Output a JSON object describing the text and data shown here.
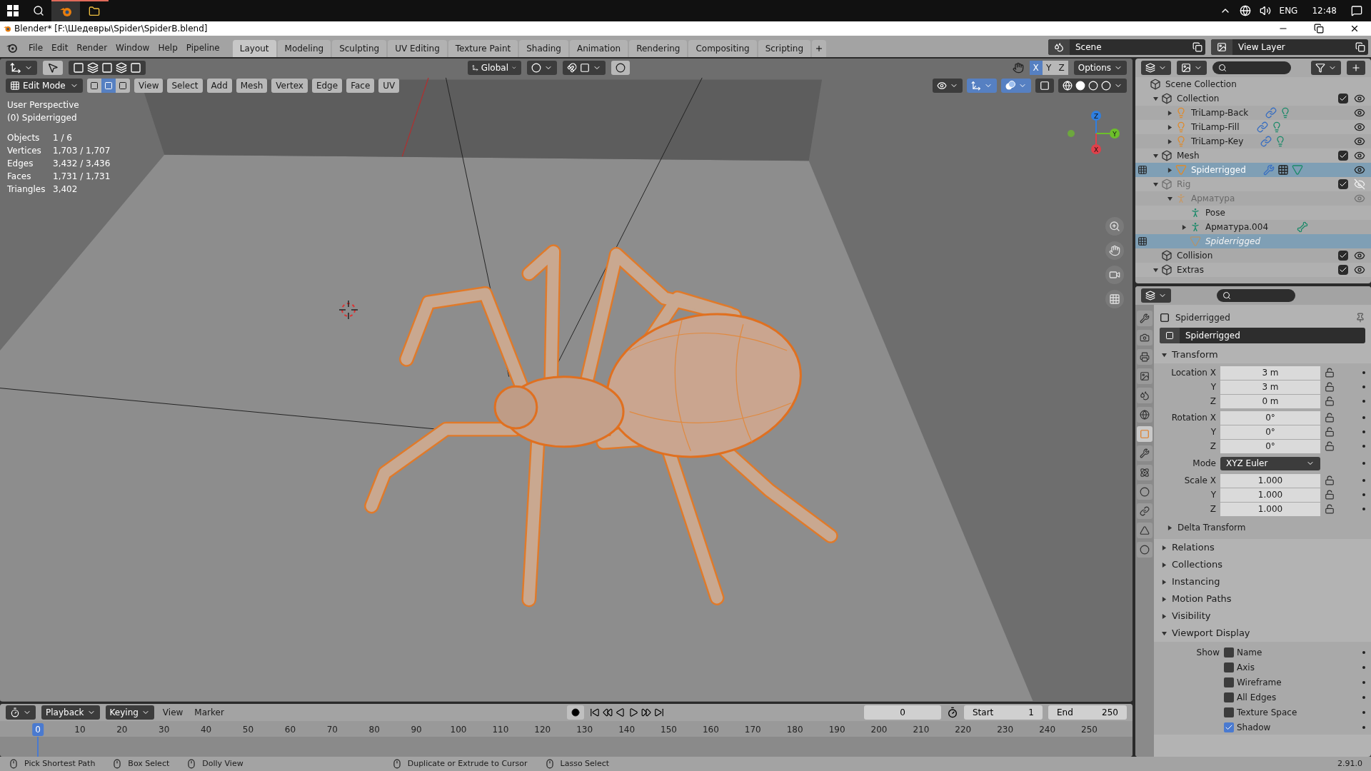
{
  "taskbar": {
    "language": "ENG",
    "time": "12:48"
  },
  "window": {
    "title": "Blender* [F:\\Шедевры\\Spider\\SpiderB.blend]"
  },
  "topbar": {
    "menus": [
      "File",
      "Edit",
      "Render",
      "Window",
      "Help",
      "Pipeline"
    ],
    "workspaces": [
      {
        "label": "Layout",
        "selected": true
      },
      {
        "label": "Modeling",
        "selected": false
      },
      {
        "label": "Sculpting",
        "selected": false
      },
      {
        "label": "UV Editing",
        "selected": false
      },
      {
        "label": "Texture Paint",
        "selected": false
      },
      {
        "label": "Shading",
        "selected": false
      },
      {
        "label": "Animation",
        "selected": false
      },
      {
        "label": "Rendering",
        "selected": false
      },
      {
        "label": "Compositing",
        "selected": false
      },
      {
        "label": "Scripting",
        "selected": false
      }
    ],
    "scene": "Scene",
    "view_layer": "View Layer"
  },
  "viewport": {
    "orientation": "Global",
    "mirror_axes": [
      {
        "label": "X",
        "selected": true
      },
      {
        "label": "Y",
        "selected": false
      },
      {
        "label": "Z",
        "selected": false
      }
    ],
    "options": "Options",
    "mode": "Edit Mode",
    "select_modes": [
      {
        "selected": false
      },
      {
        "selected": true
      },
      {
        "selected": false
      }
    ],
    "menus": [
      "View",
      "Select",
      "Add",
      "Mesh",
      "Vertex",
      "Edge",
      "Face",
      "UV"
    ],
    "gizmos": {
      "selected": true
    },
    "overlays": {
      "selected": true
    },
    "info": [
      "User Perspective",
      "(0) Spiderrigged"
    ],
    "stats": [
      {
        "label": "Objects",
        "value": "1 / 6"
      },
      {
        "label": "Vertices",
        "value": "1,703 / 1,707"
      },
      {
        "label": "Edges",
        "value": "3,432 / 3,436"
      },
      {
        "label": "Faces",
        "value": "1,731 / 1,731"
      },
      {
        "label": "Triangles",
        "value": "3,402"
      }
    ],
    "gizmo_axes": [
      {
        "label": "Z",
        "color": "#2f7fe0"
      },
      {
        "label": "Y",
        "color": "#6cbf2a"
      },
      {
        "label": "X",
        "color": "#e0404a"
      }
    ]
  },
  "outliner": {
    "root": "Scene Collection",
    "items": [
      {
        "name": "Collection",
        "kind": "collection",
        "expanded": true,
        "selected": false,
        "dimmed": false,
        "checked": true,
        "visible": true,
        "children": [
          {
            "name": "TriLamp-Back",
            "kind": "light",
            "expanded": false,
            "selected": false,
            "dimmed": false,
            "visible": true
          },
          {
            "name": "TriLamp-Fill",
            "kind": "light",
            "expanded": false,
            "selected": false,
            "dimmed": false,
            "visible": true
          },
          {
            "name": "TriLamp-Key",
            "kind": "light",
            "expanded": false,
            "selected": false,
            "dimmed": false,
            "visible": true
          }
        ]
      },
      {
        "name": "Mesh",
        "kind": "collection",
        "expanded": true,
        "selected": false,
        "dimmed": false,
        "checked": true,
        "visible": true,
        "children": [
          {
            "name": "Spiderrigged",
            "kind": "mesh",
            "expanded": false,
            "selected": true,
            "dimmed": false,
            "visible": true
          }
        ]
      },
      {
        "name": "Rig",
        "kind": "collection",
        "expanded": true,
        "selected": false,
        "dimmed": true,
        "checked": true,
        "visible": false,
        "children": [
          {
            "name": "Арматура",
            "kind": "armature",
            "expanded": true,
            "selected": false,
            "dimmed": true,
            "visible": true,
            "children": [
              {
                "name": "Pose",
                "kind": "pose",
                "selected": false,
                "dimmed": false
              },
              {
                "name": "Арматура.004",
                "kind": "armature_data",
                "expanded": false,
                "selected": false,
                "dimmed": false
              },
              {
                "name": "Spiderrigged",
                "kind": "mesh",
                "selected": true,
                "dimmed": true
              }
            ]
          }
        ]
      },
      {
        "name": "Collision",
        "kind": "collection",
        "selected": false,
        "dimmed": false,
        "checked": true,
        "visible": true
      },
      {
        "name": "Extras",
        "kind": "collection",
        "expanded": true,
        "selected": false,
        "dimmed": false,
        "checked": true,
        "visible": true
      }
    ]
  },
  "properties": {
    "tabs": [
      {
        "selected": false
      },
      {
        "selected": false
      },
      {
        "selected": false
      },
      {
        "selected": false
      },
      {
        "selected": false
      },
      {
        "selected": false
      },
      {
        "selected": true
      },
      {
        "selected": false
      },
      {
        "selected": false
      },
      {
        "selected": false
      },
      {
        "selected": false
      },
      {
        "selected": false
      },
      {
        "selected": false
      }
    ],
    "object": "Spiderrigged",
    "datablock": "Spiderrigged",
    "transform": {
      "label": "Transform",
      "expanded": true,
      "groups": [
        {
          "kind": "numbers",
          "rows": [
            {
              "label": "Location X",
              "value": "3 m"
            },
            {
              "label": "Y",
              "value": "3 m"
            },
            {
              "label": "Z",
              "value": "0 m"
            }
          ]
        },
        {
          "kind": "numbers",
          "rows": [
            {
              "label": "Rotation X",
              "value": "0°"
            },
            {
              "label": "Y",
              "value": "0°"
            },
            {
              "label": "Z",
              "value": "0°"
            }
          ]
        },
        {
          "kind": "dropdown",
          "label": "Mode",
          "value": "XYZ Euler"
        },
        {
          "kind": "numbers",
          "rows": [
            {
              "label": "Scale X",
              "value": "1.000"
            },
            {
              "label": "Y",
              "value": "1.000"
            },
            {
              "label": "Z",
              "value": "1.000"
            }
          ]
        }
      ],
      "subpanels": [
        {
          "label": "Delta Transform",
          "expanded": false
        }
      ]
    },
    "panels": [
      {
        "label": "Relations",
        "expanded": false
      },
      {
        "label": "Collections",
        "expanded": false
      },
      {
        "label": "Instancing",
        "expanded": false
      },
      {
        "label": "Motion Paths",
        "expanded": false
      },
      {
        "label": "Visibility",
        "expanded": false
      },
      {
        "label": "Viewport Display",
        "expanded": true
      }
    ],
    "viewport_display": {
      "label": "Show",
      "options": [
        {
          "label": "Name",
          "checked": false
        },
        {
          "label": "Axis",
          "checked": false
        },
        {
          "label": "Wireframe",
          "checked": false
        },
        {
          "label": "All Edges",
          "checked": false
        },
        {
          "label": "Texture Space",
          "checked": false
        },
        {
          "label": "Shadow",
          "checked": true
        }
      ]
    }
  },
  "timeline": {
    "menus": [
      "Playback",
      "Keying",
      "View",
      "Marker"
    ],
    "current_frame": "0",
    "start_label": "Start",
    "start": "1",
    "end_label": "End",
    "end": "250",
    "ticks": [
      "0",
      "10",
      "20",
      "30",
      "40",
      "50",
      "60",
      "70",
      "80",
      "90",
      "100",
      "110",
      "120",
      "130",
      "140",
      "150",
      "160",
      "170",
      "180",
      "190",
      "200",
      "210",
      "220",
      "230",
      "240",
      "250"
    ]
  },
  "status_bar": {
    "hints": [
      "Pick Shortest Path",
      "Box Select",
      "Dolly View",
      "Duplicate or Extrude to Cursor",
      "Lasso Select"
    ],
    "version": "2.91.0"
  }
}
